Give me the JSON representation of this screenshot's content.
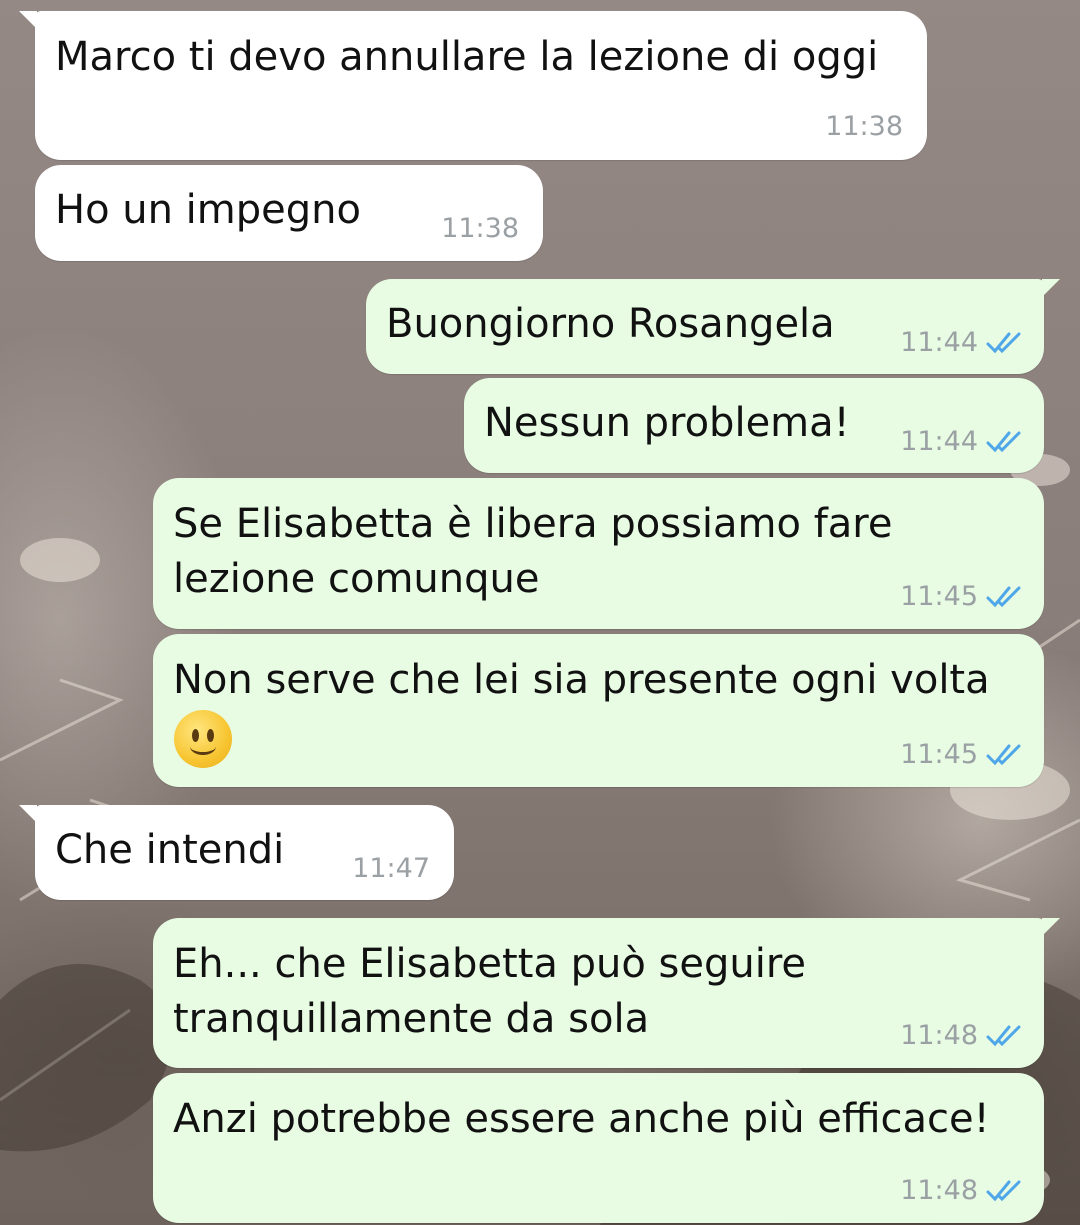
{
  "messages": [
    {
      "text": "Marco ti devo annullare la lezione di oggi",
      "time": "11:38",
      "direction": "incoming"
    },
    {
      "text": "Ho un impegno",
      "time": "11:38",
      "direction": "incoming"
    },
    {
      "text": "Buongiorno Rosangela",
      "time": "11:44",
      "direction": "outgoing",
      "status": "read"
    },
    {
      "text": "Nessun problema!",
      "time": "11:44",
      "direction": "outgoing",
      "status": "read"
    },
    {
      "line1": "Se Elisabetta è libera possiamo fare",
      "line2": "lezione comunque",
      "time": "11:45",
      "direction": "outgoing",
      "status": "read"
    },
    {
      "text": "Non serve che lei sia presente ogni volta",
      "emoji": "slightly-smiling-face-icon",
      "time": "11:45",
      "direction": "outgoing",
      "status": "read"
    },
    {
      "text": "Che intendi",
      "time": "11:47",
      "direction": "incoming"
    },
    {
      "line1": "Eh... che Elisabetta può seguire",
      "line2": "tranquillamente da sola",
      "time": "11:48",
      "direction": "outgoing",
      "status": "read"
    },
    {
      "text": "Anzi potrebbe essere anche più efficace!",
      "time": "11:48",
      "direction": "outgoing",
      "status": "read"
    }
  ],
  "colors": {
    "incoming_bubble": "#ffffff",
    "outgoing_bubble": "#e7fce3",
    "read_ticks": "#4fa6e8",
    "timestamp": "#9aa0a3"
  }
}
